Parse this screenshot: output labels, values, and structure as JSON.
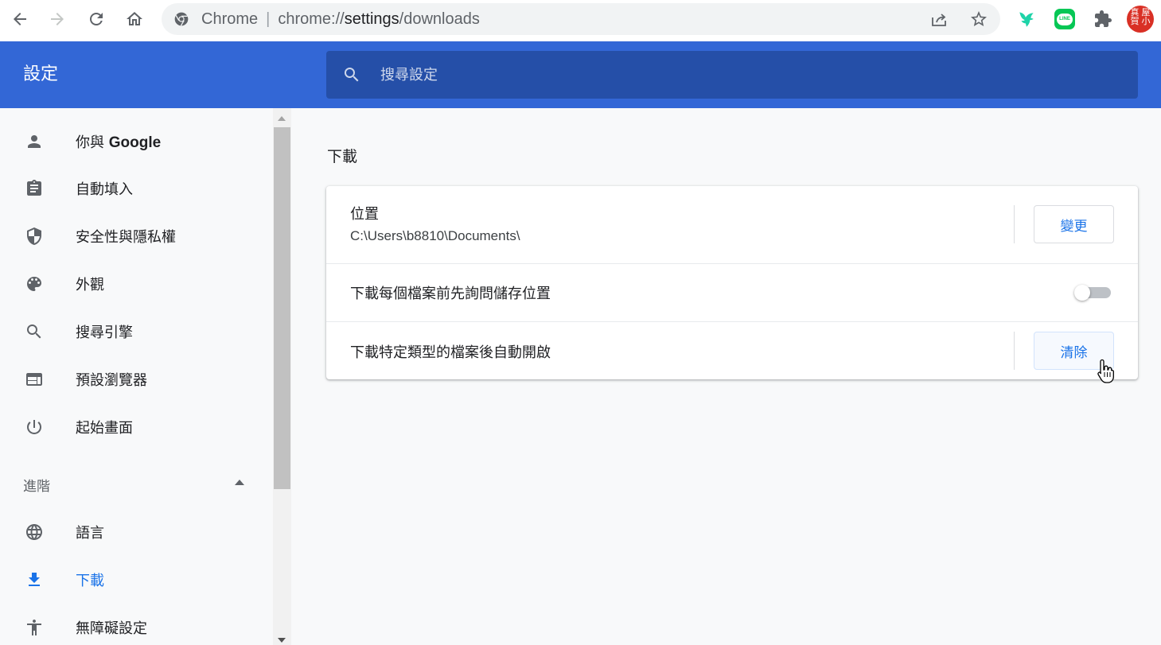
{
  "browser": {
    "site_name": "Chrome",
    "url_scheme": "chrome://",
    "url_host": "settings",
    "url_path": "/downloads",
    "extensions": [
      {
        "name": "bird-extension-icon"
      },
      {
        "name": "line-extension-icon",
        "label": "LINE"
      },
      {
        "name": "puzzle-extensions-icon"
      },
      {
        "name": "profile-avatar",
        "label_lines": [
          "賀",
          "真",
          "小",
          "屋"
        ]
      }
    ]
  },
  "header": {
    "title": "設定",
    "search_placeholder": "搜尋設定"
  },
  "sidebar": {
    "items": [
      {
        "label_prefix": "你與 ",
        "label_bold": "Google",
        "icon": "person-icon"
      },
      {
        "label": "自動填入",
        "icon": "clipboard-icon"
      },
      {
        "label": "安全性與隱私權",
        "icon": "shield-icon"
      },
      {
        "label": "外觀",
        "icon": "palette-icon"
      },
      {
        "label": "搜尋引擎",
        "icon": "search-icon"
      },
      {
        "label": "預設瀏覽器",
        "icon": "browser-window-icon"
      },
      {
        "label": "起始畫面",
        "icon": "power-icon"
      }
    ],
    "advanced_label": "進階",
    "advanced_items": [
      {
        "label": "語言",
        "icon": "globe-icon"
      },
      {
        "label": "下載",
        "icon": "download-icon",
        "active": true
      },
      {
        "label": "無障礙設定",
        "icon": "accessibility-icon"
      }
    ]
  },
  "main": {
    "section_title": "下載",
    "location_label": "位置",
    "location_path": "C:\\Users\\b8810\\Documents\\",
    "change_button": "變更",
    "ask_before_label": "下載每個檔案前先詢問儲存位置",
    "ask_before_enabled": false,
    "auto_open_label": "下載特定類型的檔案後自動開啟",
    "clear_button": "清除"
  },
  "colors": {
    "header_blue": "#3367d6",
    "search_blue": "#254fa8",
    "accent": "#1a73e8",
    "icon_gray": "#5f6368"
  }
}
